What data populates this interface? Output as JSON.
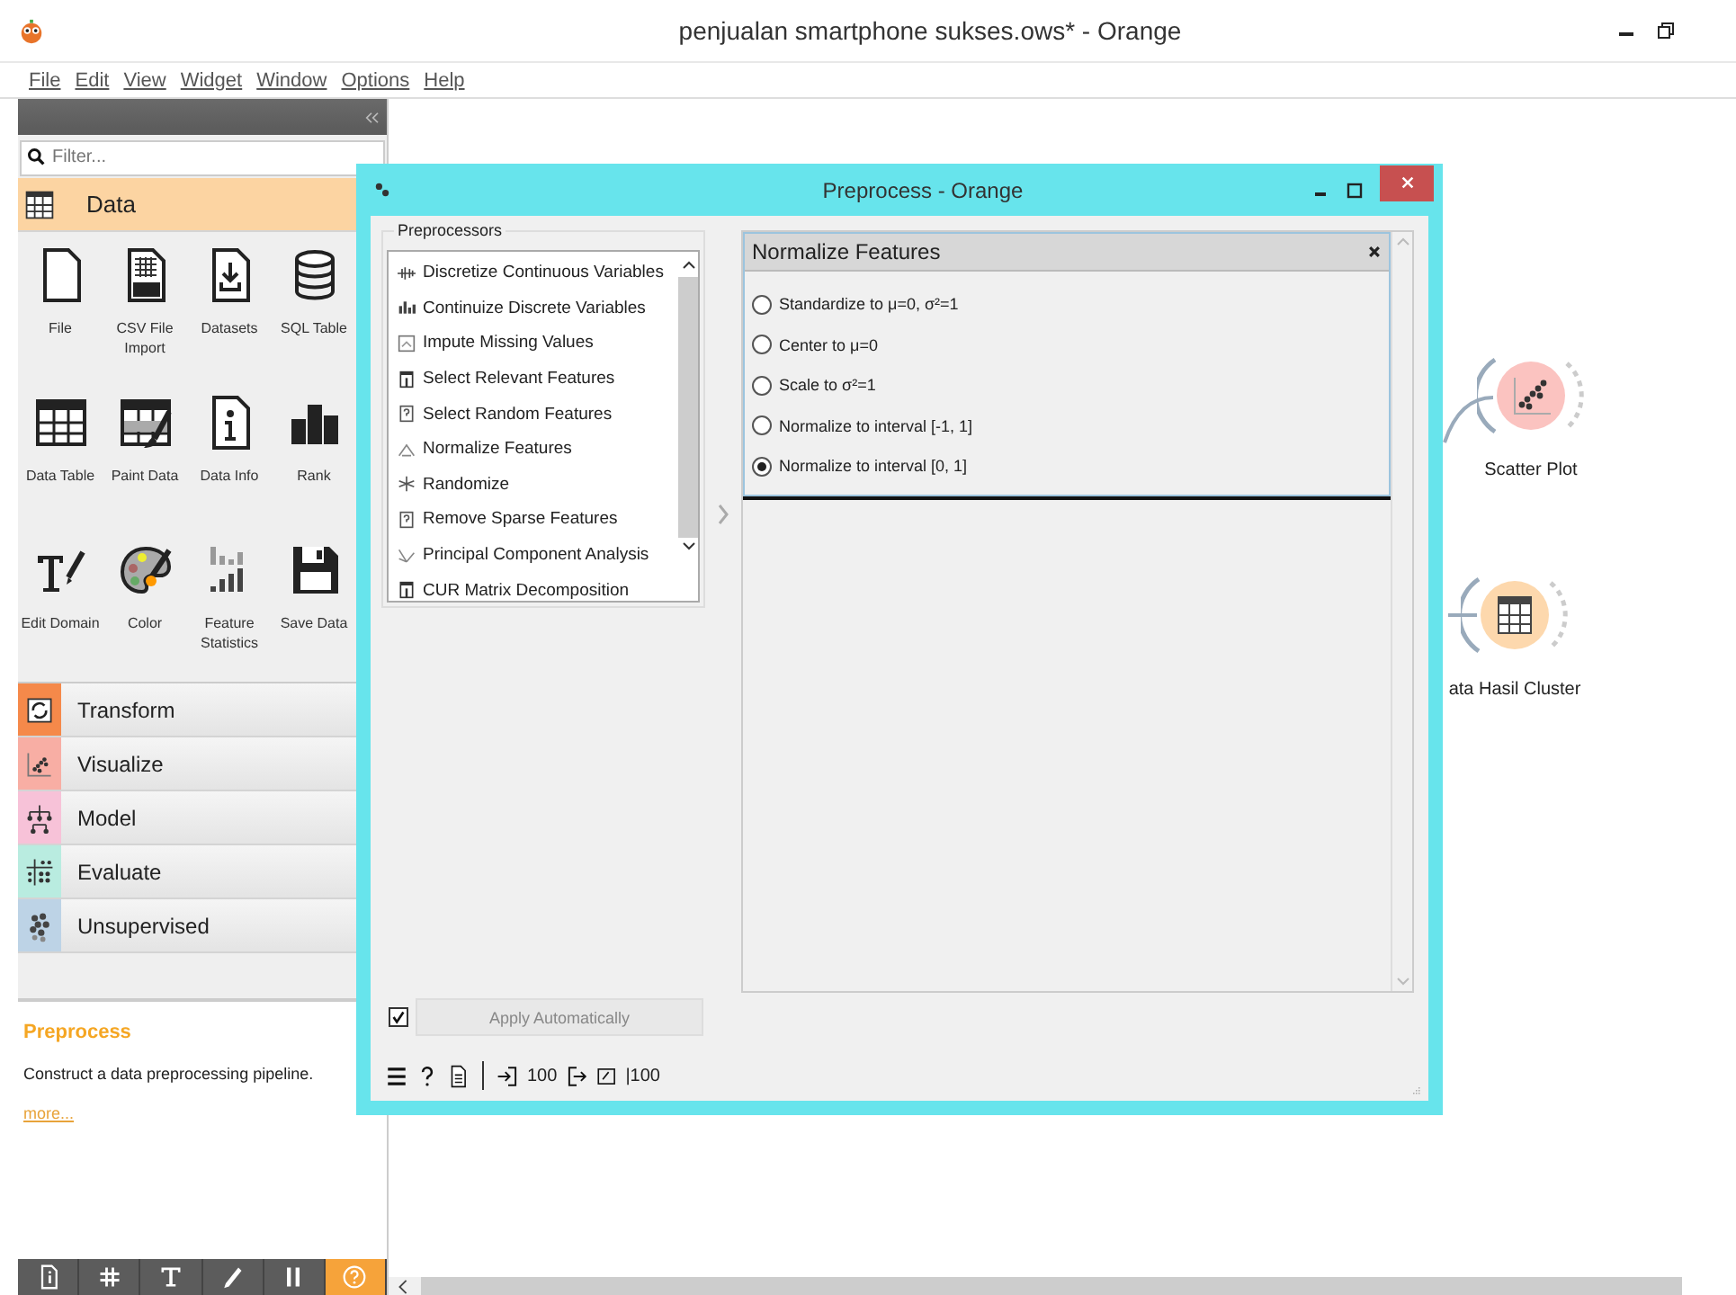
{
  "window": {
    "title": "penjualan smartphone sukses.ows* - Orange"
  },
  "menu": [
    "File",
    "Edit",
    "View",
    "Widget",
    "Window",
    "Options",
    "Help"
  ],
  "toolbox": {
    "filter": {
      "placeholder": "Filter..."
    },
    "categories": [
      {
        "name": "Data",
        "expanded": true,
        "color": "#fcd4a2",
        "widgets": [
          {
            "label": "File"
          },
          {
            "label": "CSV File Import"
          },
          {
            "label": "Datasets"
          },
          {
            "label": "SQL Table"
          },
          {
            "label": "Data Table"
          },
          {
            "label": "Paint Data"
          },
          {
            "label": "Data Info"
          },
          {
            "label": "Rank"
          },
          {
            "label": "Edit Domain"
          },
          {
            "label": "Color"
          },
          {
            "label": "Feature Statistics"
          },
          {
            "label": "Save Data"
          }
        ]
      },
      {
        "name": "Transform",
        "expanded": false,
        "color": "#f5894a"
      },
      {
        "name": "Visualize",
        "expanded": false,
        "color": "#f8aea4"
      },
      {
        "name": "Model",
        "expanded": false,
        "color": "#f7c2d8"
      },
      {
        "name": "Evaluate",
        "expanded": false,
        "color": "#b9ece0"
      },
      {
        "name": "Unsupervised",
        "expanded": false,
        "color": "#bdd3e6"
      }
    ]
  },
  "description": {
    "title": "Preprocess",
    "text": "Construct a data preprocessing pipeline.",
    "link": "more..."
  },
  "toolbar_buttons": [
    {
      "selected": false
    },
    {
      "selected": false
    },
    {
      "selected": false
    },
    {
      "selected": false
    },
    {
      "selected": false
    },
    {
      "selected": true
    }
  ],
  "canvas": {
    "nodes": [
      {
        "label": "Scatter Plot",
        "kind": "scatter",
        "color": "#fbc3c0"
      },
      {
        "label": "ata Hasil Cluster",
        "kind": "table",
        "color": "#fdd8ad"
      }
    ]
  },
  "dialog": {
    "title": "Preprocess - Orange",
    "preprocessors": {
      "title": "Preprocessors",
      "items": [
        {
          "label": "Discretize Continuous Variables"
        },
        {
          "label": "Continuize Discrete Variables"
        },
        {
          "label": "Impute Missing Values"
        },
        {
          "label": "Select Relevant Features"
        },
        {
          "label": "Select Random Features"
        },
        {
          "label": "Normalize Features"
        },
        {
          "label": "Randomize"
        },
        {
          "label": "Remove Sparse Features"
        },
        {
          "label": "Principal Component Analysis"
        },
        {
          "label": "CUR Matrix Decomposition"
        }
      ]
    },
    "editor": {
      "title": "Normalize Features",
      "options": [
        {
          "label": "Standardize to μ=0, σ²=1",
          "selected": false
        },
        {
          "label": "Center to μ=0",
          "selected": false
        },
        {
          "label": "Scale to σ²=1",
          "selected": false
        },
        {
          "label": "Normalize to interval [-1, 1]",
          "selected": false
        },
        {
          "label": "Normalize to interval [0, 1]",
          "selected": true
        }
      ]
    },
    "apply": {
      "label": "Apply Automatically",
      "checked": true,
      "disabled": true
    },
    "status": {
      "input": "100",
      "output": "|100"
    }
  }
}
